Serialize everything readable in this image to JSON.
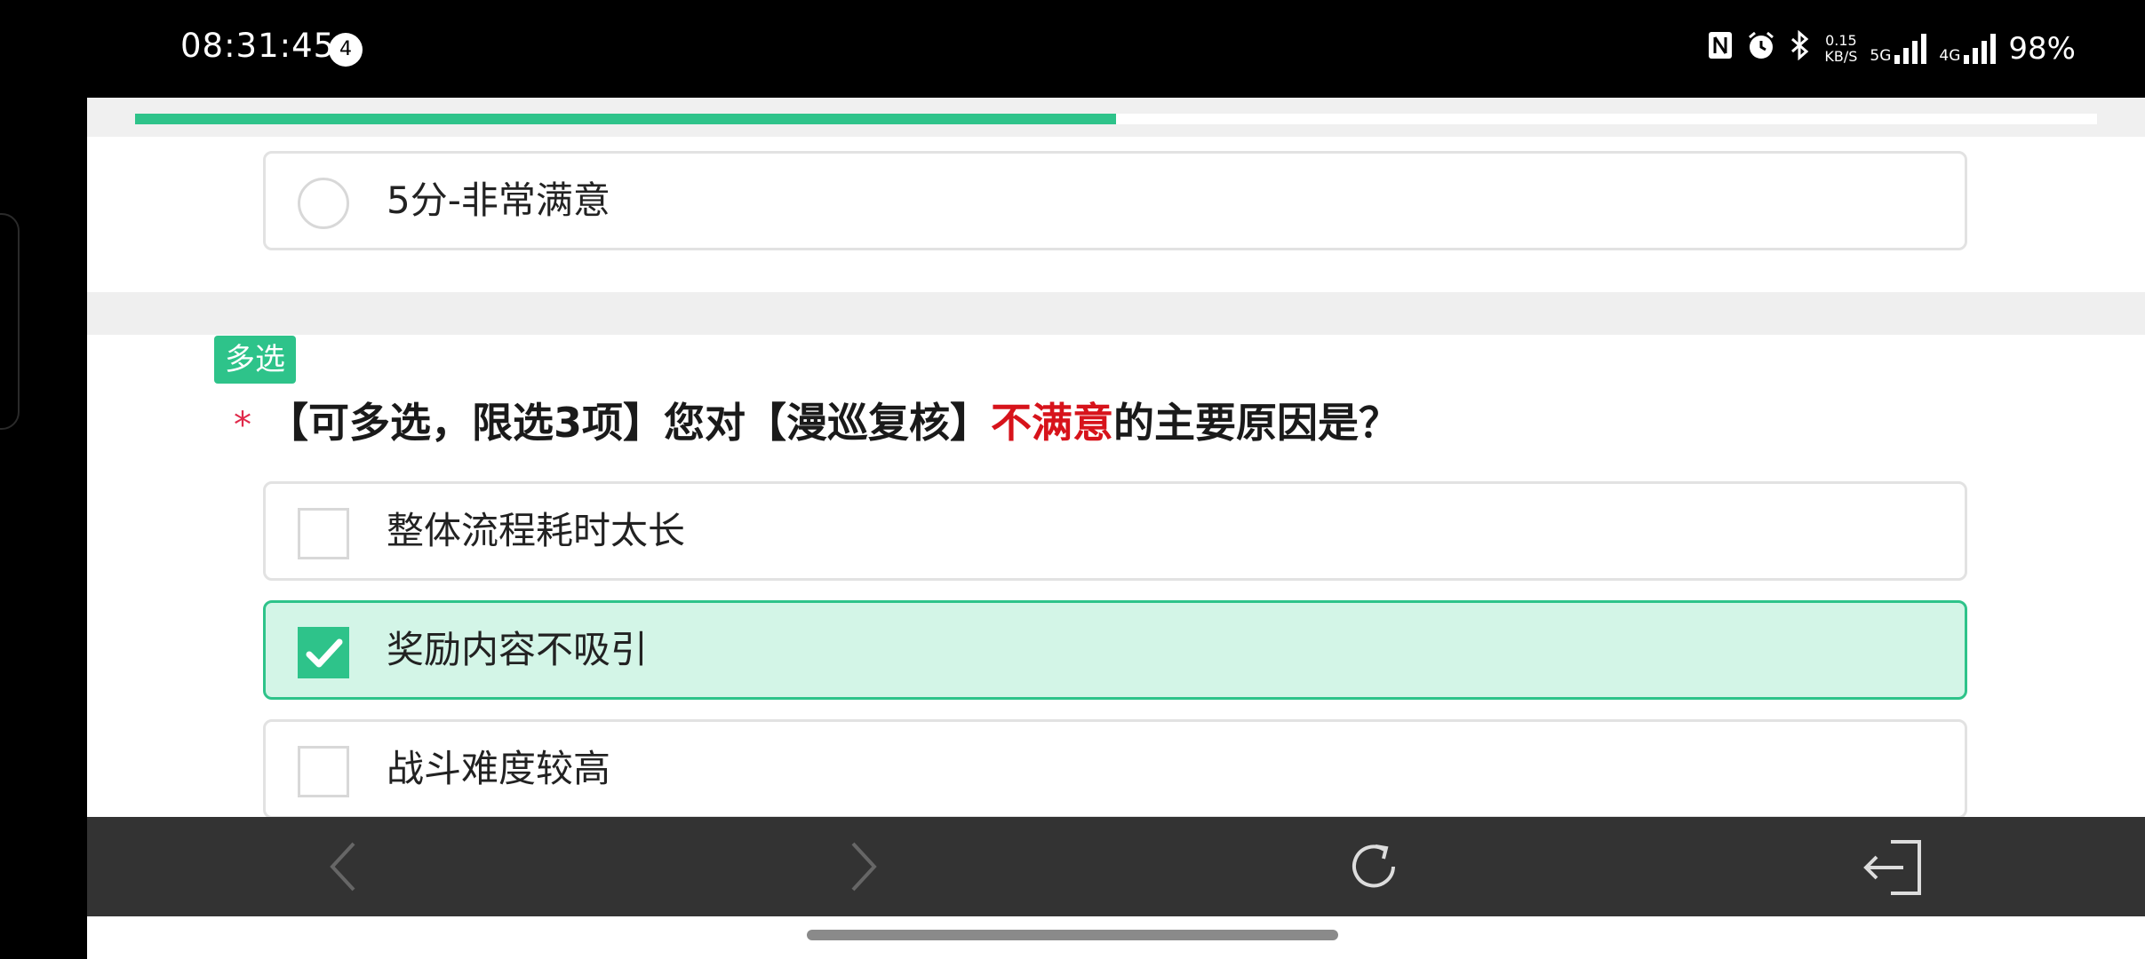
{
  "status_bar": {
    "time": "08:31:45",
    "notification_count": "4",
    "speed_value": "0.15",
    "speed_unit": "KB/S",
    "net_5g": "5G",
    "net_4g": "4G",
    "battery": "98%"
  },
  "progress": {
    "fraction": 0.5
  },
  "prev_question": {
    "option_label": "5分-非常满意"
  },
  "question": {
    "type_tag": "多选",
    "required_mark": "*",
    "text_before": "【可多选，限选3项】您对【漫巡复核】",
    "text_highlight": "不满意",
    "text_after": "的主要原因是？",
    "options": [
      {
        "label": "整体流程耗时太长",
        "checked": false
      },
      {
        "label": "奖励内容不吸引",
        "checked": true
      },
      {
        "label": "战斗难度较高",
        "checked": false
      }
    ]
  },
  "colors": {
    "accent": "#2ec38a",
    "selected_bg": "#d3f5e7",
    "highlight_red": "#d7131b",
    "required_red": "#e0294a"
  },
  "nav_icons": [
    "back-icon",
    "forward-icon",
    "refresh-icon",
    "exit-icon"
  ]
}
